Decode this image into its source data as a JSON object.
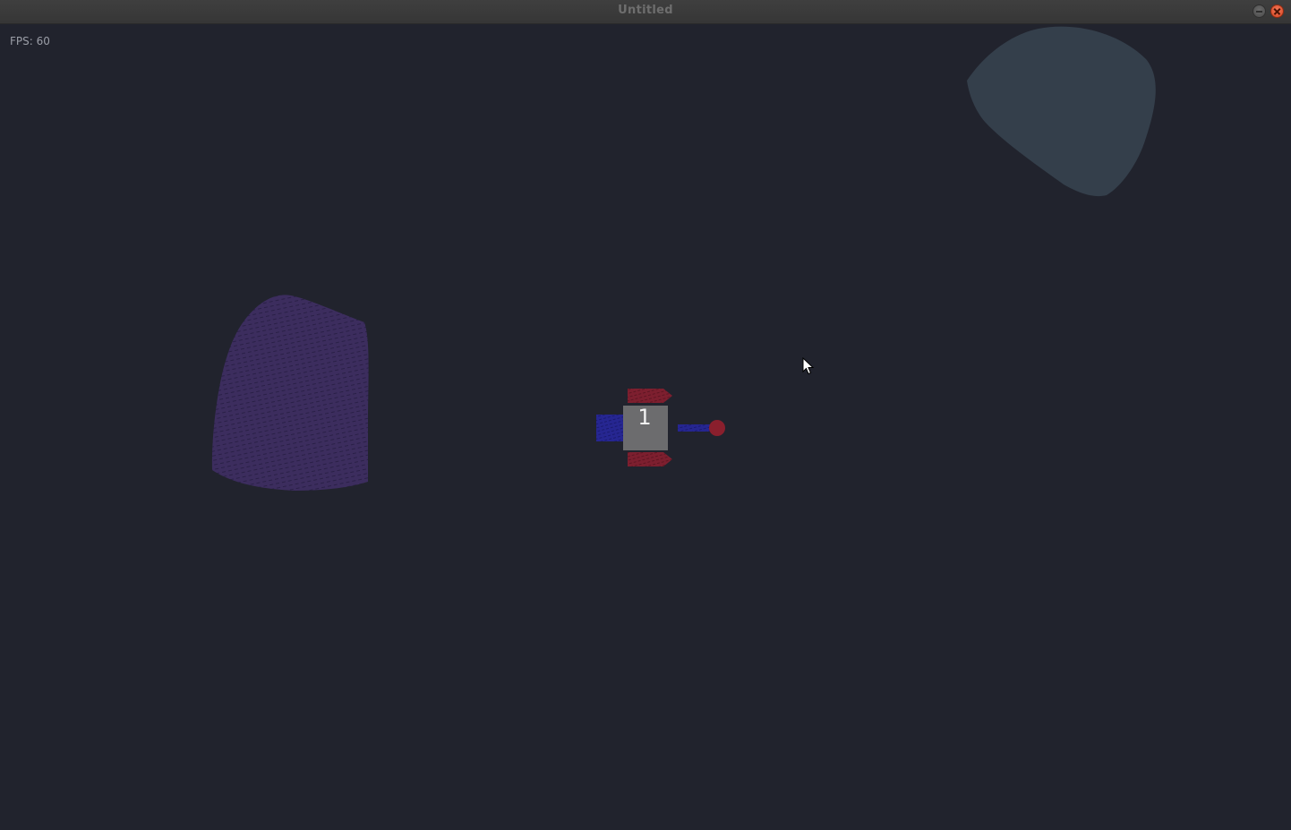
{
  "window": {
    "title": "Untitled"
  },
  "hud": {
    "fps_label": "FPS: 60"
  },
  "player": {
    "number": "1"
  },
  "colors": {
    "background": "#21232d",
    "asteroid_slate": "#343f4b",
    "asteroid_purple": "#3c2d5e",
    "hull": "#6c6c6e",
    "thrusters": "#7d1f2f",
    "rear_engine": "#262691",
    "gun": "#262691",
    "projectile": "#8a1f2d"
  },
  "icons": {
    "minimize": "minimize-icon",
    "close": "close-icon",
    "cursor": "mouse-pointer-icon"
  }
}
